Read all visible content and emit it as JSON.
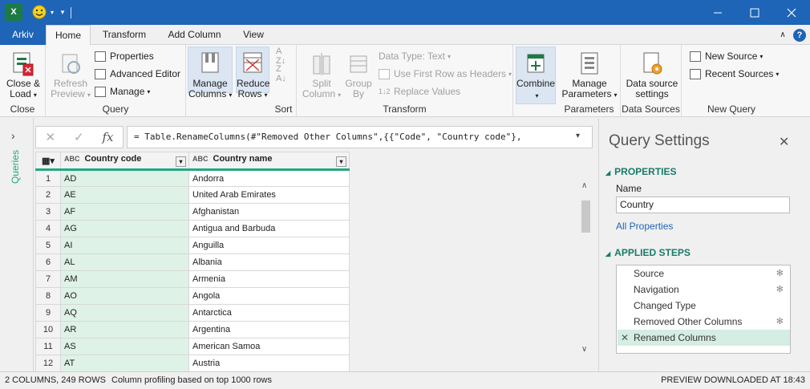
{
  "titlebar": {
    "app_icon": "X",
    "controls": [
      "minimize-icon",
      "maximize-icon",
      "close-icon"
    ]
  },
  "tabs": {
    "file": "Arkiv",
    "home": "Home",
    "transform": "Transform",
    "add_column": "Add Column",
    "view": "View"
  },
  "ribbon": {
    "close_load": {
      "line1": "Close &",
      "line2": "Load",
      "group": "Close"
    },
    "refresh": {
      "line1": "Refresh",
      "line2": "Preview"
    },
    "properties": "Properties",
    "advanced_editor": "Advanced Editor",
    "manage": "Manage",
    "query_group": "Query",
    "manage_columns": {
      "line1": "Manage",
      "line2": "Columns"
    },
    "reduce_rows": {
      "line1": "Reduce",
      "line2": "Rows"
    },
    "sort_group": "Sort",
    "split_column": {
      "line1": "Split",
      "line2": "Column"
    },
    "group_by": {
      "line1": "Group",
      "line2": "By"
    },
    "data_type": "Data Type: Text",
    "first_row": "Use First Row as Headers",
    "replace_values": "Replace Values",
    "transform_group": "Transform",
    "combine": "Combine",
    "manage_parameters": {
      "line1": "Manage",
      "line2": "Parameters"
    },
    "parameters_group": "Parameters",
    "data_source": {
      "line1": "Data source",
      "line2": "settings"
    },
    "data_sources_group": "Data Sources",
    "new_source": "New Source",
    "recent_sources": "Recent Sources",
    "new_query_group": "New Query"
  },
  "queries_pane": {
    "label": "Queries"
  },
  "formula": {
    "fx": "fx",
    "text": "= Table.RenameColumns(#\"Removed Other Columns\",{{\"Code\", \"Country code\"},"
  },
  "table": {
    "type_icon": "ABC",
    "columns": [
      "Country code",
      "Country name"
    ],
    "rows": [
      [
        "1",
        "AD",
        "Andorra"
      ],
      [
        "2",
        "AE",
        "United Arab Emirates"
      ],
      [
        "3",
        "AF",
        "Afghanistan"
      ],
      [
        "4",
        "AG",
        "Antigua and Barbuda"
      ],
      [
        "5",
        "AI",
        "Anguilla"
      ],
      [
        "6",
        "AL",
        "Albania"
      ],
      [
        "7",
        "AM",
        "Armenia"
      ],
      [
        "8",
        "AO",
        "Angola"
      ],
      [
        "9",
        "AQ",
        "Antarctica"
      ],
      [
        "10",
        "AR",
        "Argentina"
      ],
      [
        "11",
        "AS",
        "American Samoa"
      ],
      [
        "12",
        "AT",
        "Austria"
      ]
    ]
  },
  "settings": {
    "title": "Query Settings",
    "properties_header": "PROPERTIES",
    "name_label": "Name",
    "name_value": "Country",
    "all_properties": "All Properties",
    "steps_header": "APPLIED STEPS",
    "steps": [
      {
        "label": "Source",
        "gear": true
      },
      {
        "label": "Navigation",
        "gear": true
      },
      {
        "label": "Changed Type",
        "gear": false
      },
      {
        "label": "Removed Other Columns",
        "gear": true
      },
      {
        "label": "Renamed Columns",
        "gear": false,
        "selected": true
      }
    ]
  },
  "status": {
    "left": "2 COLUMNS, 249 ROWS",
    "profiling": "Column profiling based on top 1000 rows",
    "right": "PREVIEW DOWNLOADED AT 18:43"
  },
  "colors": {
    "title_blue": "#1e64b7",
    "accent_green": "#22a884",
    "column_green": "#dff2e8",
    "excel_green": "#1d7a45"
  }
}
